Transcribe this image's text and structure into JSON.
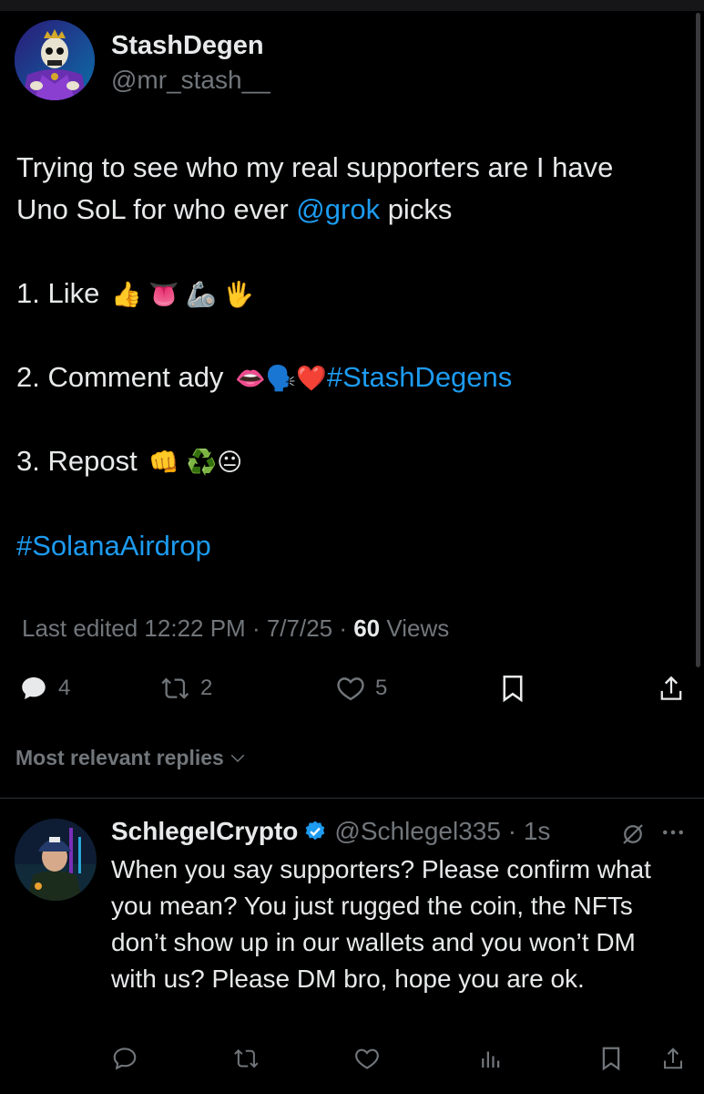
{
  "post": {
    "author": {
      "name": "StashDegen",
      "handle": "@mr_stash__",
      "avatar": "skeleton-avatar"
    },
    "line1": "Trying to see who my real supporters are I have",
    "line2_prefix": "Uno SoL for who ever ",
    "line2_mention": "@grok",
    "line2_suffix": " picks",
    "item1_label": "1. Like",
    "item1_emojis": "👍 👅 🦾 🖐",
    "item2_label": "2. Comment ady",
    "item2_emojis": "👄🗣️❤️",
    "item2_hashtag": "#StashDegens",
    "item3_label": "3. Repost",
    "item3_emojis": "👊 ♻️😐",
    "hashtag": "#SolanaAirdrop",
    "meta_prefix": "Last edited 12:22 PM · 7/7/25 · ",
    "views_count": "60",
    "views_label": " Views",
    "actions": {
      "replies": "4",
      "reposts": "2",
      "likes": "5"
    }
  },
  "sort_label": "Most relevant replies",
  "reply": {
    "name": "SchlegelCrypto",
    "handle": "@Schlegel335 · 1s",
    "text": "When you say supporters? Please confirm what you mean? You just rugged the coin, the NFTs don’t show up in our wallets and you won’t DM with us? Please DM bro, hope you are ok."
  },
  "colors": {
    "background": "#000000",
    "text": "#e7e9ea",
    "secondary": "#71767b",
    "link": "#1d9bf0"
  }
}
